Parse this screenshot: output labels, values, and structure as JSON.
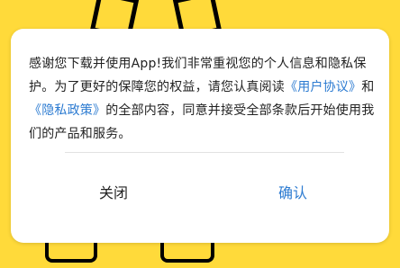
{
  "colors": {
    "background": "#FFDA3A",
    "dialog": "#FFFFFF",
    "text": "#222222",
    "link": "#2C7BD1",
    "divider": "#E2E2E2",
    "outline": "#000000"
  },
  "dialog": {
    "message_part1": "感谢您下载并使用App!我们非常重视您的个人信息和隐私保护。为了更好的保障您的权益，请您认真阅读",
    "user_agreement_link": "《用户协议》",
    "message_and": "和",
    "privacy_policy_link": "《隐私政策》",
    "message_part2": "的全部内容，同意并接受全部条款后开始使用我们的产品和服务。",
    "close_label": "关闭",
    "confirm_label": "确认"
  }
}
